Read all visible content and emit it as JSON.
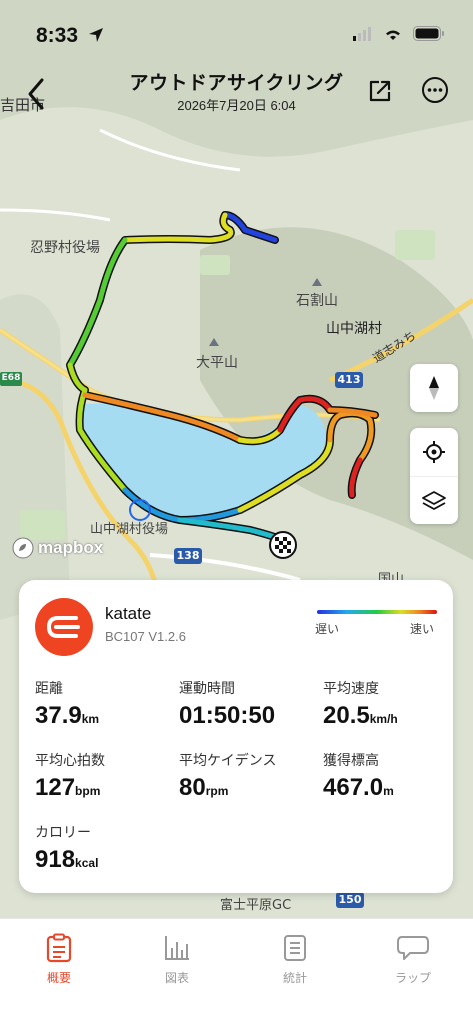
{
  "status_bar": {
    "time": "8:33"
  },
  "header": {
    "title": "アウトドアサイクリング",
    "subtitle": "2026年7月20日 6:04"
  },
  "map": {
    "labels": {
      "yoshida": "吉田市",
      "oshino": "忍野村役場",
      "ishiwari": "石割山",
      "yamanakako": "山中湖村",
      "ohira": "大平山",
      "yamanakako_office": "山中湖村役場",
      "michishi": "道志みち",
      "fuji_heigen": "富士平原GC",
      "koyama": "国山",
      "route_413": "413",
      "route_138": "138",
      "route_150": "150",
      "e68": "E68"
    },
    "attribution": "mapbox"
  },
  "summary": {
    "device_name": "katate",
    "device_model": "BC107  V1.2.6",
    "legend_slow": "遅い",
    "legend_fast": "速い",
    "stats": [
      {
        "label": "距離",
        "value": "37.9",
        "unit": "km"
      },
      {
        "label": "運動時間",
        "value": "01:50:50",
        "unit": ""
      },
      {
        "label": "平均速度",
        "value": "20.5",
        "unit": "km/h"
      },
      {
        "label": "平均心拍数",
        "value": "127",
        "unit": "bpm"
      },
      {
        "label": "平均ケイデンス",
        "value": "80",
        "unit": "rpm"
      },
      {
        "label": "獲得標高",
        "value": "467.0",
        "unit": "m"
      },
      {
        "label": "カロリー",
        "value": "918",
        "unit": "kcal"
      }
    ]
  },
  "nav": {
    "items": [
      {
        "label": "概要"
      },
      {
        "label": "図表"
      },
      {
        "label": "統計"
      },
      {
        "label": "ラップ"
      }
    ]
  },
  "colors": {
    "accent": "#e8472a",
    "lake": "#a6dcf2",
    "route_outline": "#111111"
  }
}
